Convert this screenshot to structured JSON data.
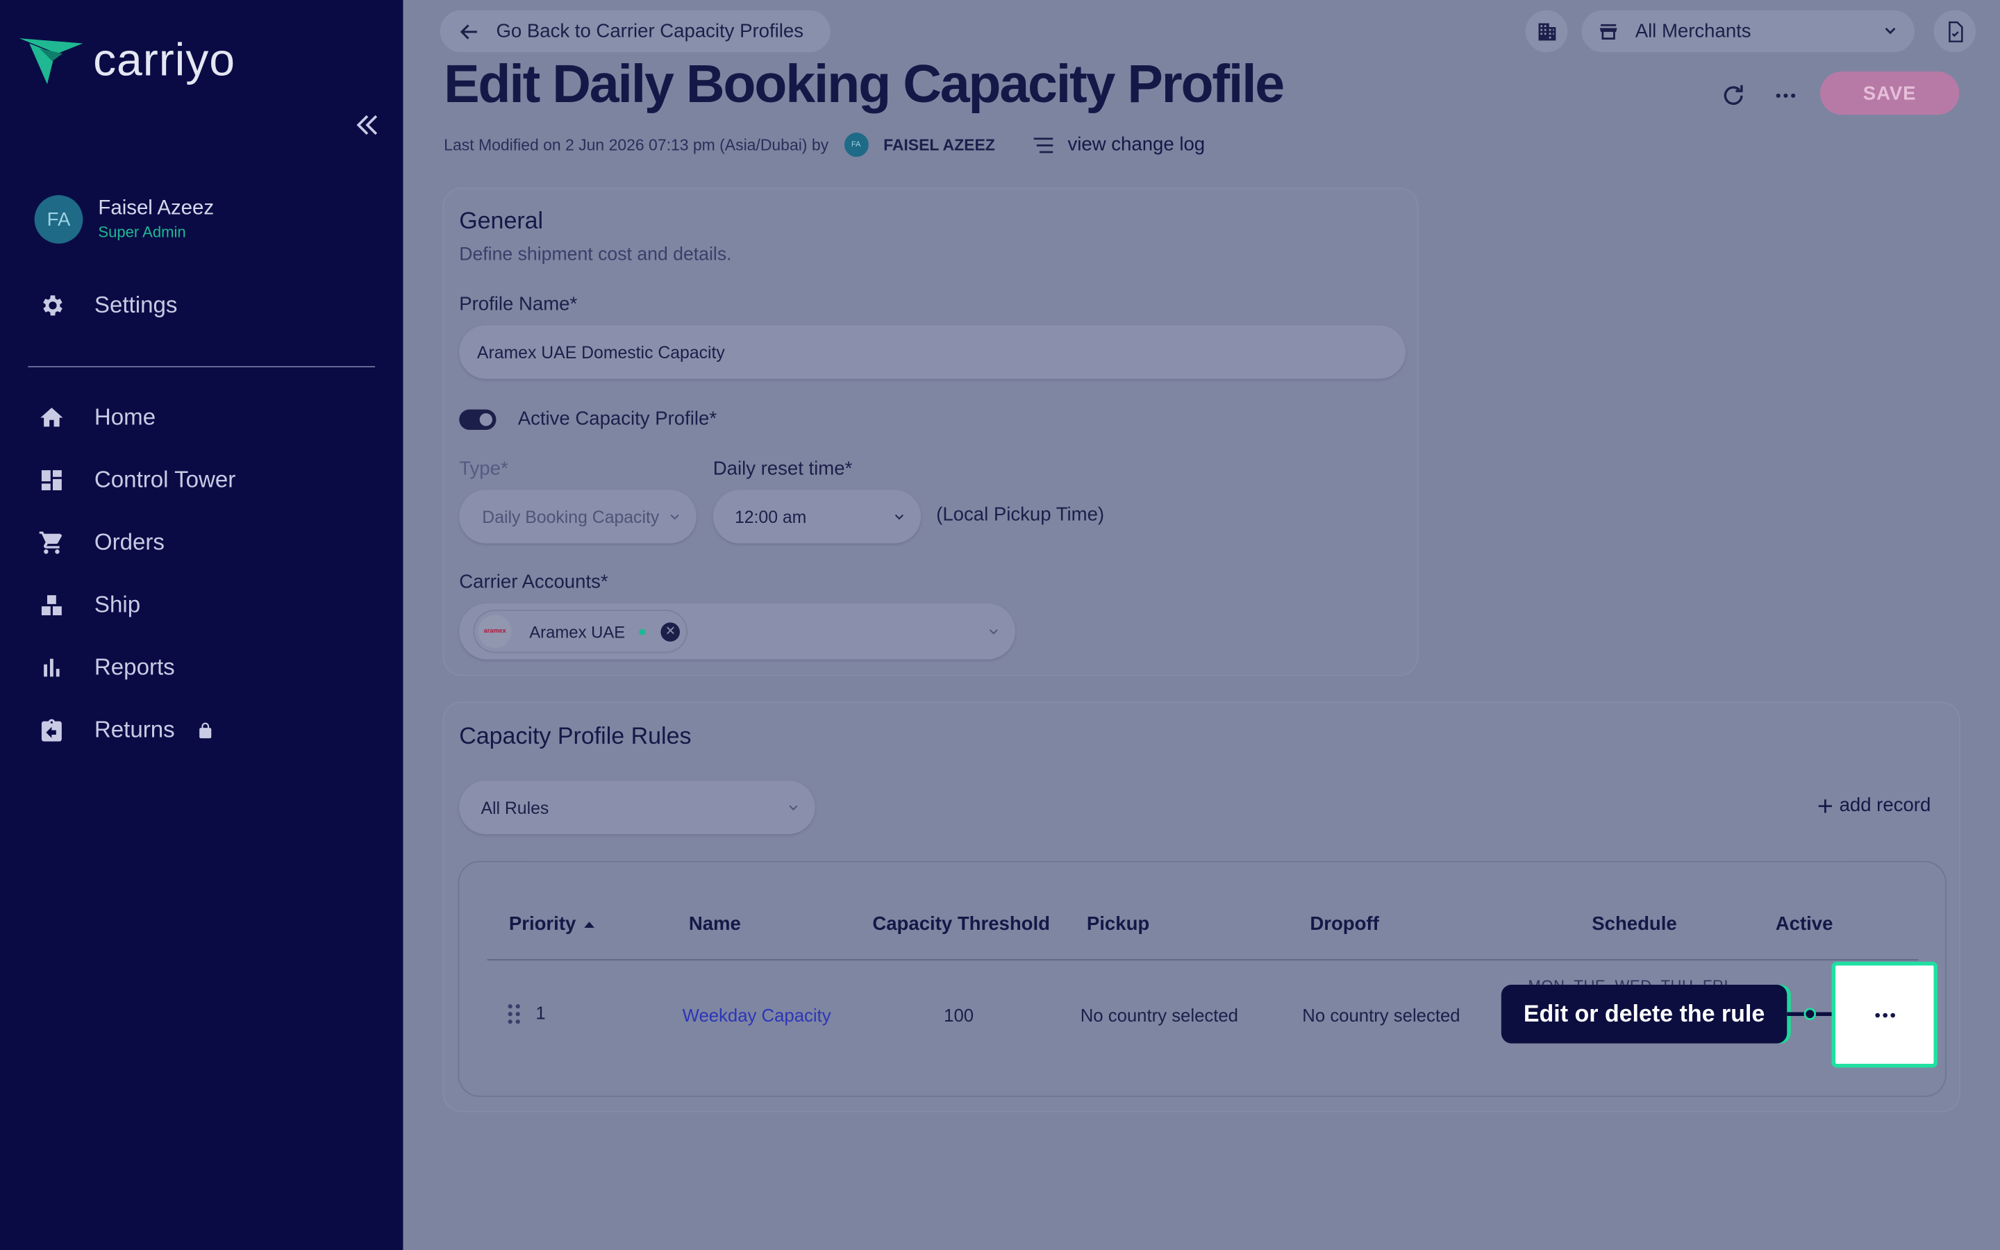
{
  "brand": {
    "name": "carriyo",
    "accent": "#1fb892"
  },
  "user": {
    "initials": "FA",
    "name": "Faisel Azeez",
    "role": "Super Admin"
  },
  "nav": {
    "settings": "Settings",
    "items": [
      {
        "label": "Home",
        "icon": "home-icon"
      },
      {
        "label": "Control Tower",
        "icon": "dashboard-icon"
      },
      {
        "label": "Orders",
        "icon": "cart-icon"
      },
      {
        "label": "Ship",
        "icon": "boxes-icon"
      },
      {
        "label": "Reports",
        "icon": "bar-chart-icon"
      },
      {
        "label": "Returns",
        "icon": "returns-icon",
        "locked": true
      }
    ]
  },
  "header": {
    "back": "Go Back to Carrier Capacity Profiles",
    "merchant_select": "All Merchants",
    "title": "Edit Daily Booking Capacity Profile",
    "save": "SAVE",
    "meta_prefix": "Last Modified on 2 Jun 2026 07:13 pm (Asia/Dubai) by",
    "meta_initials": "FA",
    "meta_user": "FAISEL AZEEZ",
    "change_log": "view change log"
  },
  "general": {
    "title": "General",
    "subtitle": "Define shipment cost and details.",
    "profile_name_label": "Profile Name*",
    "profile_name_value": "Aramex UAE Domestic Capacity",
    "active_label": "Active Capacity Profile*",
    "active": true,
    "type_label": "Type*",
    "type_value": "Daily Booking Capacity",
    "reset_label": "Daily reset time*",
    "reset_value": "12:00 am",
    "reset_note": "(Local Pickup Time)",
    "carrier_label": "Carrier Accounts*",
    "carrier_chip": "Aramex UAE",
    "carrier_logo_text": "aramex"
  },
  "rules": {
    "title": "Capacity Profile Rules",
    "filter": "All Rules",
    "add": "add record",
    "columns": {
      "priority": "Priority",
      "name": "Name",
      "threshold": "Capacity Threshold",
      "pickup": "Pickup",
      "dropoff": "Dropoff",
      "schedule": "Schedule",
      "active": "Active"
    },
    "rows": [
      {
        "priority": "1",
        "name": "Weekday Capacity",
        "threshold": "100",
        "pickup": "No country selected",
        "dropoff": "No country selected",
        "schedule": "MON, TUE, WED, THU, FRI"
      }
    ]
  },
  "tooltip": {
    "text": "Edit or delete the rule",
    "highlight_color": "#1fe0a2"
  }
}
